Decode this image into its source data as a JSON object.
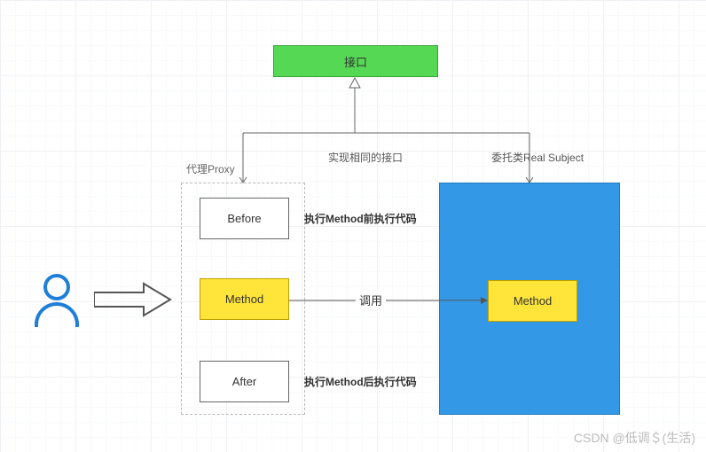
{
  "interface": {
    "label": "接口"
  },
  "proxy": {
    "title": "代理Proxy",
    "before": {
      "label": "Before",
      "desc": "执行Method前执行代码"
    },
    "method": {
      "label": "Method"
    },
    "after": {
      "label": "After",
      "desc": "执行Method后执行代码"
    }
  },
  "subject": {
    "title": "委托类Real Subject",
    "method": {
      "label": "Method"
    }
  },
  "edges": {
    "implements": "实现相同的接口",
    "call": "调用"
  },
  "watermark": "CSDN @低调＄(生活)"
}
